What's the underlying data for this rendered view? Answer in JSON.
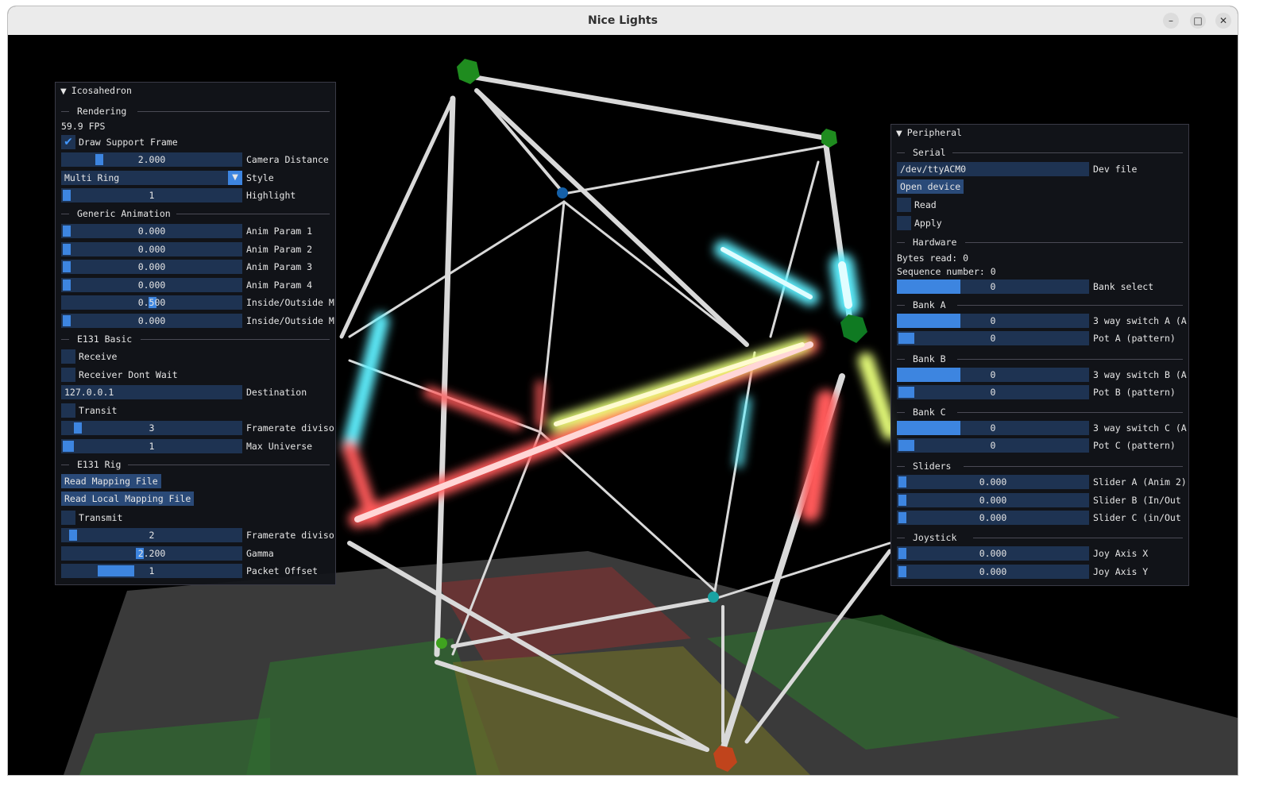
{
  "window": {
    "title": "Nice Lights",
    "minimize_icon": "minimize-icon",
    "maximize_icon": "maximize-icon",
    "close_icon": "close-icon"
  },
  "left_panel": {
    "title": "Icosahedron",
    "rendering": {
      "header": "Rendering",
      "fps": "59.9 FPS",
      "draw_support_frame": {
        "label": "Draw Support Frame",
        "checked": true
      },
      "camera_distance": {
        "value": "2.000",
        "label": "Camera Distance"
      },
      "style": {
        "value": "Multi Ring",
        "label": "Style"
      },
      "highlight": {
        "value": "1",
        "label": "Highlight"
      }
    },
    "generic_animation": {
      "header": "Generic Animation",
      "params": [
        {
          "value": "0.000",
          "label": "Anim Param 1"
        },
        {
          "value": "0.000",
          "label": "Anim Param 2"
        },
        {
          "value": "0.000",
          "label": "Anim Param 3"
        },
        {
          "value": "0.000",
          "label": "Anim Param 4"
        },
        {
          "value": "0.500",
          "label": "Inside/Outside M"
        },
        {
          "value": "0.000",
          "label": "Inside/Outside M"
        }
      ]
    },
    "e131_basic": {
      "header": "E131 Basic",
      "receive": {
        "label": "Receive",
        "checked": false
      },
      "receiver_dont_wait": {
        "label": "Receiver Dont Wait",
        "checked": false
      },
      "destination": {
        "value": "127.0.0.1",
        "label": "Destination"
      },
      "transit": {
        "label": "Transit",
        "checked": false
      },
      "framerate_divisor": {
        "value": "3",
        "label": "Framerate diviso"
      },
      "max_universe": {
        "value": "1",
        "label": "Max Universe"
      }
    },
    "e131_rig": {
      "header": "E131 Rig",
      "read_mapping_file": "Read Mapping File",
      "read_local_mapping_file": "Read Local Mapping File",
      "transmit": {
        "label": "Transmit",
        "checked": false
      },
      "framerate_divisor": {
        "value": "2",
        "label": "Framerate diviso"
      },
      "gamma": {
        "value": "2.200",
        "label": "Gamma"
      },
      "packet_offset": {
        "value": "1",
        "label": "Packet Offset"
      }
    }
  },
  "right_panel": {
    "title": "Peripheral",
    "serial": {
      "header": "Serial",
      "dev_file": {
        "value": "/dev/ttyACM0",
        "label": "Dev file"
      },
      "open_device": "Open device",
      "read": {
        "label": "Read",
        "checked": false
      },
      "apply": {
        "label": "Apply",
        "checked": false
      }
    },
    "hardware": {
      "header": "Hardware",
      "bytes_read": "Bytes read: 0",
      "sequence_number": "Sequence number: 0",
      "bank_select": {
        "value": "0",
        "label": "Bank select",
        "fill": 0.33
      }
    },
    "bank_a": {
      "header": "Bank A",
      "switch": {
        "value": "0",
        "label": "3 way switch A (A",
        "fill": 0.33
      },
      "pot": {
        "value": "0",
        "label": "Pot A (pattern)"
      }
    },
    "bank_b": {
      "header": "Bank B",
      "switch": {
        "value": "0",
        "label": "3 way switch B (A",
        "fill": 0.33
      },
      "pot": {
        "value": "0",
        "label": "Pot B (pattern)"
      }
    },
    "bank_c": {
      "header": "Bank C",
      "switch": {
        "value": "0",
        "label": "3 way switch C (A",
        "fill": 0.33
      },
      "pot": {
        "value": "0",
        "label": "Pot C (pattern)"
      }
    },
    "sliders": {
      "header": "Sliders",
      "items": [
        {
          "value": "0.000",
          "label": "Slider A (Anim 2)"
        },
        {
          "value": "0.000",
          "label": "Slider B (In/Out"
        },
        {
          "value": "0.000",
          "label": "Slider C (in/Out"
        }
      ]
    },
    "joystick": {
      "header": "Joystick",
      "items": [
        {
          "value": "0.000",
          "label": "Joy Axis X"
        },
        {
          "value": "0.000",
          "label": "Joy Axis Y"
        }
      ]
    }
  }
}
